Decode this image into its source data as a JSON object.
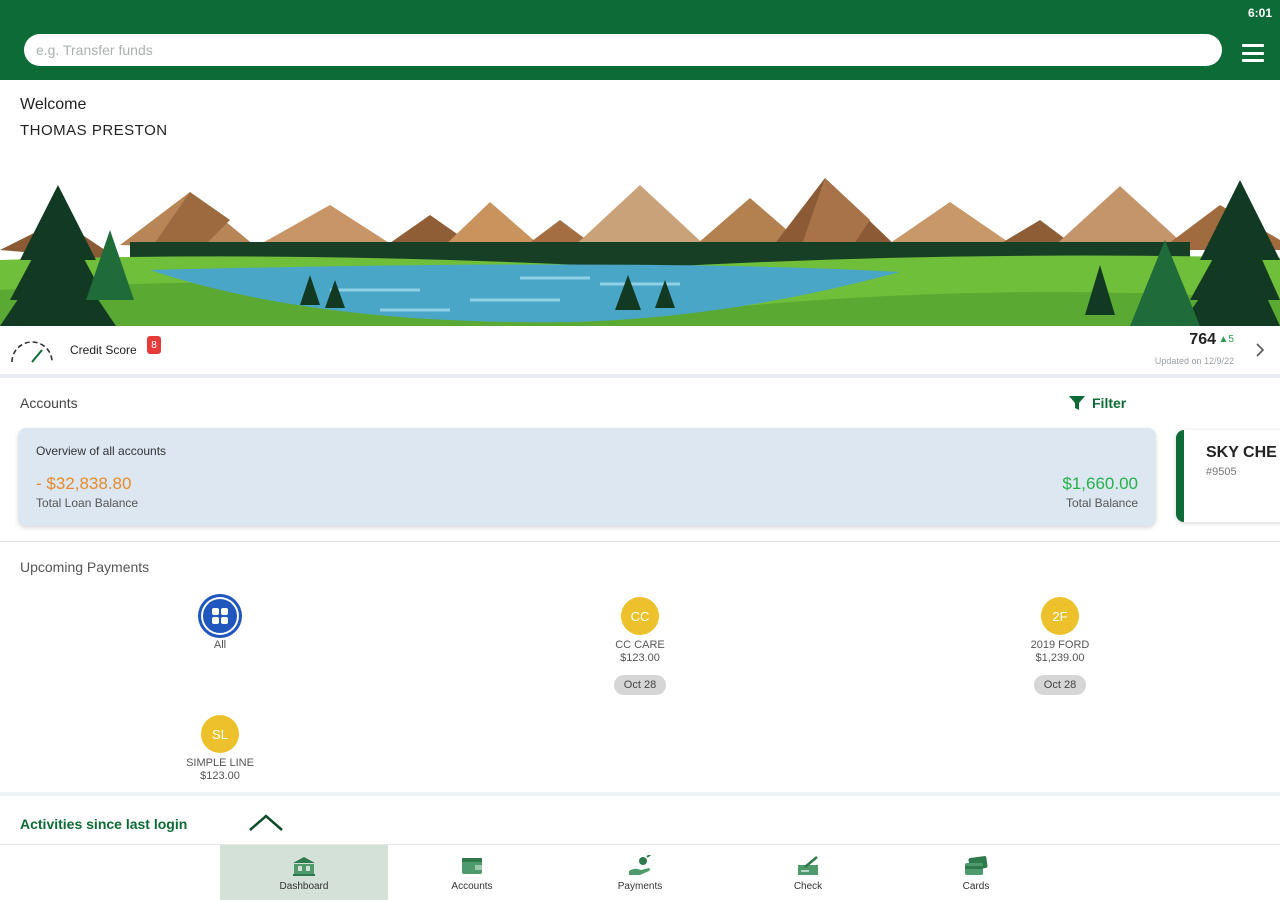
{
  "status_bar": {
    "time": "6:01"
  },
  "search": {
    "placeholder": "e.g. Transfer funds"
  },
  "welcome": {
    "greeting": "Welcome",
    "name": "THOMAS PRESTON"
  },
  "credit": {
    "label": "Credit Score",
    "badge": "8",
    "score": "764",
    "change": "▲5",
    "updated": "Updated on 12/9/22"
  },
  "accounts": {
    "title": "Accounts",
    "filter_label": "Filter",
    "overview": {
      "title": "Overview of all accounts",
      "loan_value": "- $32,838.80",
      "loan_label": "Total Loan Balance",
      "balance_value": "$1,660.00",
      "balance_label": "Total Balance"
    },
    "card": {
      "title": "SKY CHE",
      "number": "#9505"
    }
  },
  "payments": {
    "title": "Upcoming Payments",
    "items": [
      {
        "initials": "",
        "name": "All",
        "amount": "",
        "date": ""
      },
      {
        "initials": "CC",
        "name": "CC CARE",
        "amount": "$123.00",
        "date": "Oct 28"
      },
      {
        "initials": "2F",
        "name": "2019 FORD",
        "amount": "$1,239.00",
        "date": "Oct 28"
      },
      {
        "initials": "SL",
        "name": "SIMPLE LINE",
        "amount": "$123.00",
        "date": ""
      }
    ]
  },
  "activities": {
    "title": "Activities since last login"
  },
  "nav": {
    "items": [
      {
        "label": "Dashboard",
        "icon": "bank-icon"
      },
      {
        "label": "Accounts",
        "icon": "wallet-icon"
      },
      {
        "label": "Payments",
        "icon": "payment-hand-icon"
      },
      {
        "label": "Check",
        "icon": "check-deposit-icon"
      },
      {
        "label": "Cards",
        "icon": "cards-icon"
      }
    ]
  },
  "colors": {
    "brand_green": "#0c6b36",
    "loan_orange": "#e58a2e",
    "balance_green": "#25b14a",
    "coin_yellow": "#ecc12b",
    "all_blue": "#1f57bd"
  }
}
